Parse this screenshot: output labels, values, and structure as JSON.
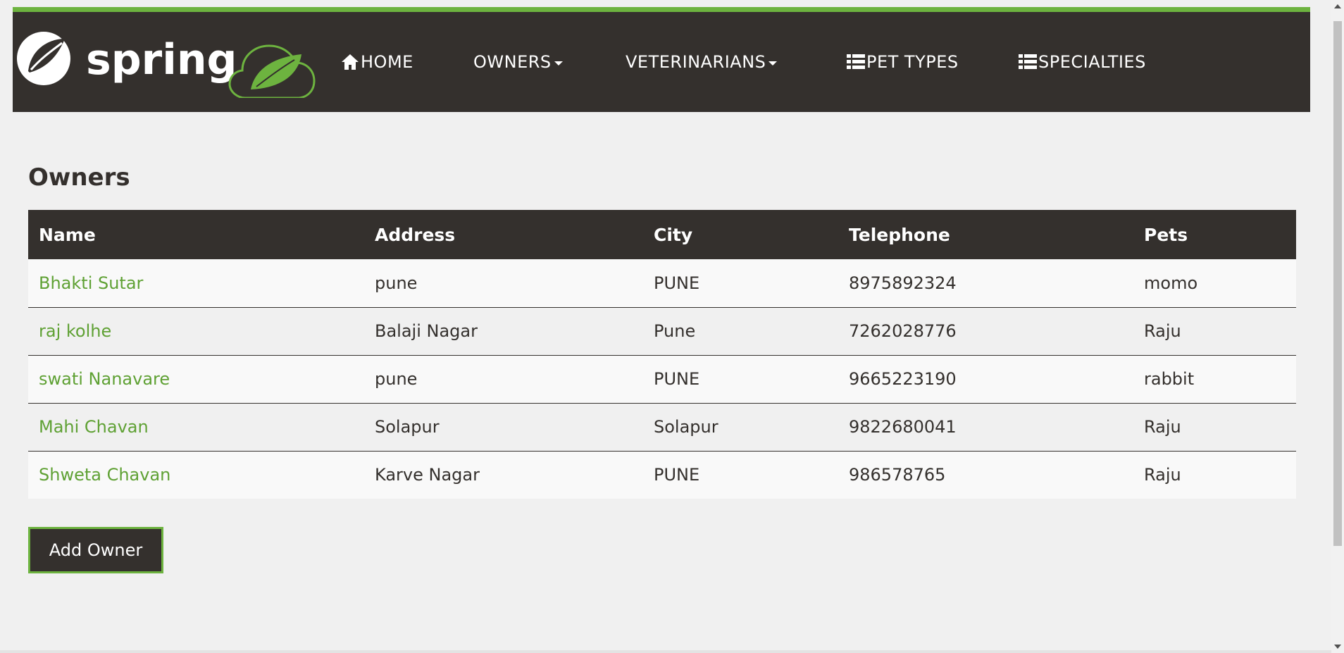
{
  "nav": {
    "brand": "spring",
    "home_label": "HOME",
    "owners_label": "OWNERS",
    "vets_label": "VETERINARIANS",
    "pettypes_label": "PET TYPES",
    "specialties_label": "SPECIALTIES"
  },
  "colors": {
    "accent": "#6db33f",
    "navbar": "#34302d",
    "link": "#5fa134",
    "background": "#f0f0f0"
  },
  "page": {
    "title": "Owners"
  },
  "table": {
    "headers": {
      "name": "Name",
      "address": "Address",
      "city": "City",
      "telephone": "Telephone",
      "pets": "Pets"
    },
    "rows": [
      {
        "name": "Bhakti Sutar",
        "address": "pune",
        "city": "PUNE",
        "telephone": "8975892324",
        "pets": "momo"
      },
      {
        "name": "raj kolhe",
        "address": "Balaji Nagar",
        "city": "Pune",
        "telephone": "7262028776",
        "pets": "Raju"
      },
      {
        "name": "swati Nanavare",
        "address": "pune",
        "city": "PUNE",
        "telephone": "9665223190",
        "pets": "rabbit"
      },
      {
        "name": "Mahi Chavan",
        "address": "Solapur",
        "city": "Solapur",
        "telephone": "9822680041",
        "pets": "Raju"
      },
      {
        "name": "Shweta Chavan",
        "address": "Karve Nagar",
        "city": "PUNE",
        "telephone": "986578765",
        "pets": "Raju"
      }
    ]
  },
  "actions": {
    "add_owner_label": "Add Owner"
  },
  "icons": {
    "home": "home-icon",
    "pettypes": "list-icon",
    "specialties": "list-icon",
    "caret": "caret-down-icon",
    "logo": "spring-leaf-logo"
  }
}
